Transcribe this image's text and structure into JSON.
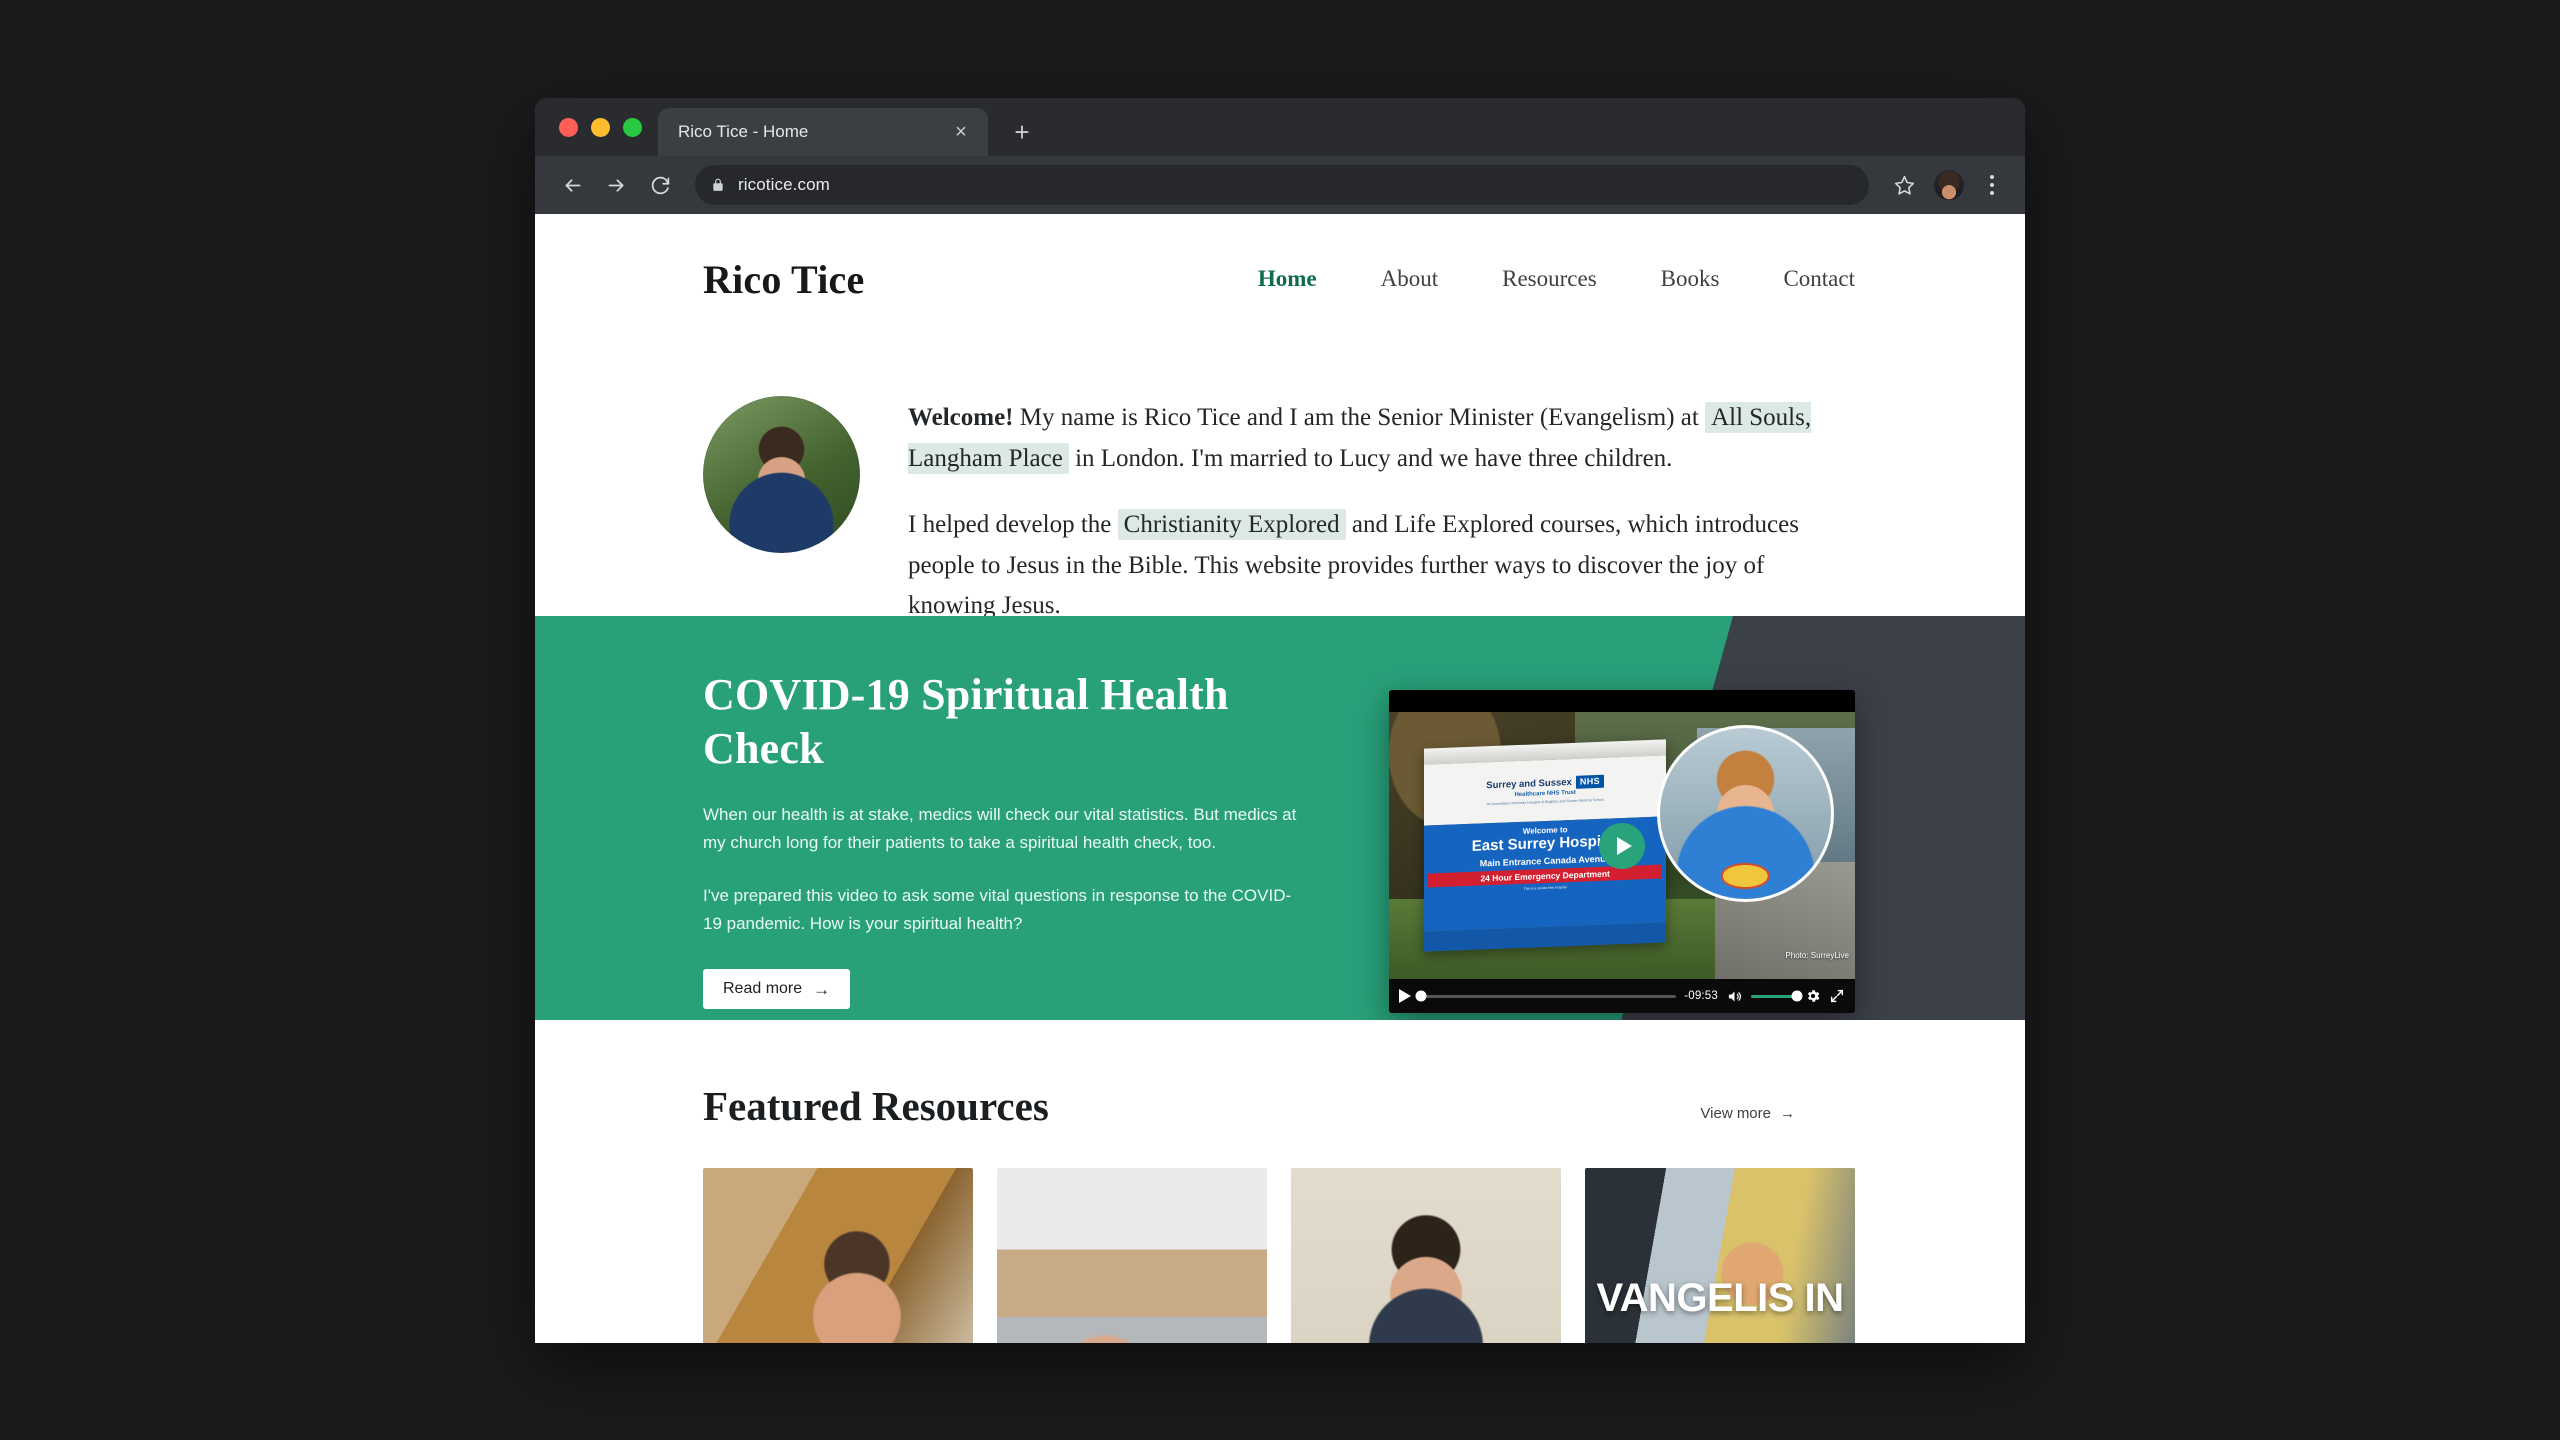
{
  "browser": {
    "tab_title": "Rico Tice - Home",
    "tab_close_label": "×",
    "new_tab_label": "+",
    "url": "ricotice.com",
    "back_icon": "back-arrow-icon",
    "forward_icon": "forward-arrow-icon",
    "reload_icon": "reload-icon",
    "lock_icon": "lock-icon",
    "bookmark_icon": "star-icon",
    "profile_icon": "avatar-icon",
    "menu_icon": "kebab-menu-icon"
  },
  "site": {
    "logo": "Rico Tice",
    "nav": [
      {
        "label": "Home",
        "active": true
      },
      {
        "label": "About",
        "active": false
      },
      {
        "label": "Resources",
        "active": false
      },
      {
        "label": "Books",
        "active": false
      },
      {
        "label": "Contact",
        "active": false
      }
    ]
  },
  "intro": {
    "greeting": "Welcome!",
    "p1_before": " My name is Rico Tice and I am the Senior Minister (Evangelism) at ",
    "p1_link": "All Souls, Langham Place",
    "p1_after": " in London. I'm married to Lucy and we have three children.",
    "p2_before": "I helped develop the ",
    "p2_link": "Christianity Explored",
    "p2_after": " and Life Explored courses, which introduces people to Jesus in the Bible. This website provides further ways to discover the joy of knowing Jesus."
  },
  "hero": {
    "title": "COVID-19 Spiritual Health Check",
    "paragraph1": "When our health is at stake, medics will check our vital statistics. But medics at my church long for their patients to take a spiritual health check, too.",
    "paragraph2": "I've prepared this video to ask some vital questions in response to the COVID-19 pandemic. How is your spiritual health?",
    "button_label": "Read more",
    "button_arrow": "→",
    "background_color": "#28a07a",
    "backdrop_color": "#3c4148"
  },
  "video": {
    "play_overlay_icon": "play-circle-icon",
    "accent_color": "#29a37c",
    "sign": {
      "trust_name": "Surrey and Sussex",
      "nhs_badge": "NHS",
      "trust_sub": "Healthcare NHS Trust",
      "trust_tiny": "An Associated University Hospital of Brighton and Sussex Medical School",
      "welcome": "Welcome to",
      "hospital": "East Surrey Hospital",
      "entrance": "Main Entrance Canada Avenue",
      "emergency": "24 Hour Emergency Department",
      "smokefree": "This is a smoke free hospital"
    },
    "photo_credit": "Photo: SurreyLive",
    "controls": {
      "play_icon": "play-icon",
      "time_remaining": "-09:53",
      "volume_icon": "volume-icon",
      "settings_icon": "gear-icon",
      "fullscreen_icon": "fullscreen-icon"
    }
  },
  "featured": {
    "title": "Featured Resources",
    "view_more_label": "View more",
    "view_more_arrow": "→",
    "cards": [
      {
        "name": "resource-card-1",
        "overlay": ""
      },
      {
        "name": "resource-card-2",
        "overlay": ""
      },
      {
        "name": "resource-card-3",
        "overlay": ""
      },
      {
        "name": "resource-card-4",
        "overlay": "VANGELIS\nIN"
      }
    ]
  }
}
